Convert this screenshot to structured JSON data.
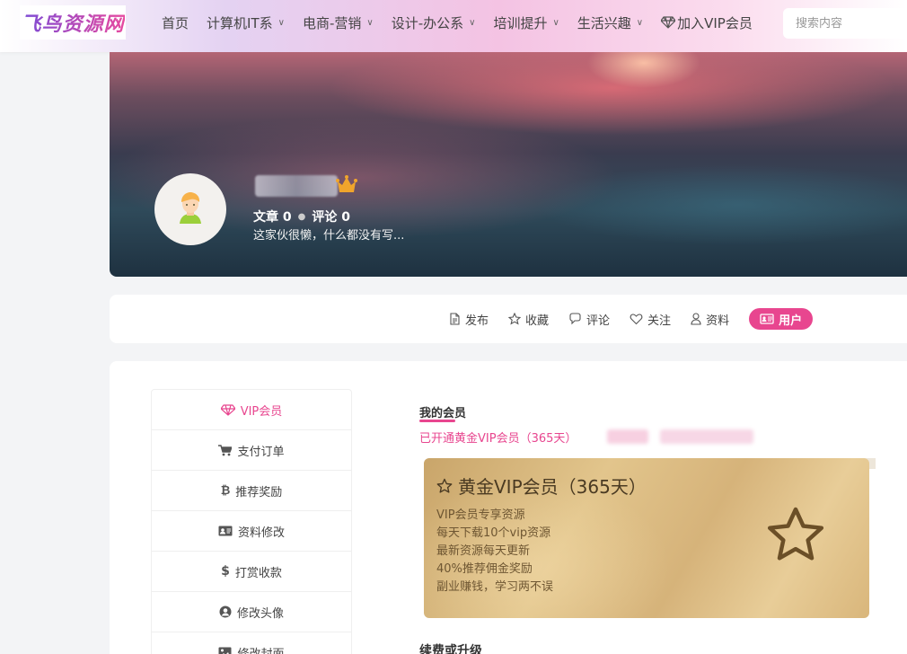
{
  "logo": {
    "text": "飞鸟资源网"
  },
  "nav": {
    "items": [
      {
        "label": "首页",
        "has_dropdown": false
      },
      {
        "label": "计算机IT系",
        "has_dropdown": true
      },
      {
        "label": "电商-营销",
        "has_dropdown": true
      },
      {
        "label": "设计-办公系",
        "has_dropdown": true
      },
      {
        "label": "培训提升",
        "has_dropdown": true
      },
      {
        "label": "生活兴趣",
        "has_dropdown": true
      }
    ],
    "vip_label": "加入VIP会员",
    "search_placeholder": "搜索内容"
  },
  "profile": {
    "stats": {
      "posts": "文章 0",
      "comments": "评论 0"
    },
    "bio": "这家伙很懒，什么都没有写..."
  },
  "actions": {
    "publish": "发布",
    "favorites": "收藏",
    "comments": "评论",
    "follow": "关注",
    "profile": "资料",
    "user": "用户"
  },
  "sidebar": {
    "items": [
      {
        "label": "VIP会员",
        "icon": "diamond-icon",
        "active": true
      },
      {
        "label": "支付订单",
        "icon": "cart-icon",
        "active": false
      },
      {
        "label": "推荐奖励",
        "icon": "bitcoin-icon",
        "active": false
      },
      {
        "label": "资料修改",
        "icon": "id-card-icon",
        "active": false
      },
      {
        "label": "打赏收款",
        "icon": "dollar-icon",
        "active": false
      },
      {
        "label": "修改头像",
        "icon": "user-circle-icon",
        "active": false
      },
      {
        "label": "修改封面",
        "icon": "image-icon",
        "active": false
      }
    ]
  },
  "membership": {
    "section_title": "我的会员",
    "status": "已开通黄金VIP会员（365天）",
    "card": {
      "title": "黄金VIP会员（365天）",
      "features": [
        "VIP会员专享资源",
        "每天下载10个vip资源",
        "最新资源每天更新",
        "40%推荐佣金奖励",
        "副业赚钱，学习两不误"
      ]
    },
    "renew_title": "续费或升级"
  },
  "colors": {
    "accent": "#e8468f",
    "gold_card": "#dcbc82",
    "page_bg": "#f3f4f6"
  }
}
